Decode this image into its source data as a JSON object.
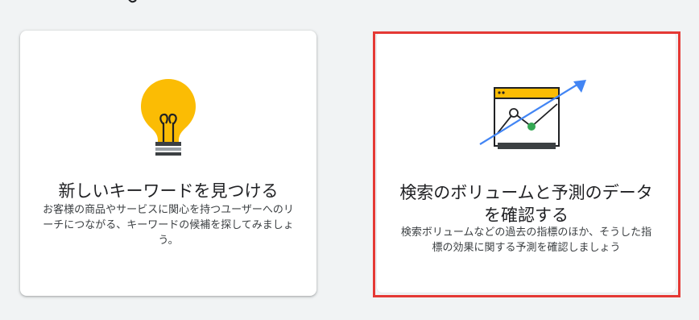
{
  "cards": [
    {
      "title": "新しいキーワードを見つける",
      "description": "お客様の商品やサービスに関心を持つユーザーへのリーチにつながる、キーワードの候補を探してみましょう。",
      "icon": "lightbulb-icon"
    },
    {
      "title": "検索のボリュームと予測のデータを確認する",
      "description": "検索ボリュームなどの過去の指標のほか、そうした指標の効果に関する予測を確認しましょう",
      "icon": "forecast-chart-icon"
    }
  ],
  "colors": {
    "bulb": "#fbbc04",
    "window_bar": "#fbbc04",
    "arrow": "#4285f4",
    "point": "#34a853",
    "highlight": "#e53935"
  }
}
